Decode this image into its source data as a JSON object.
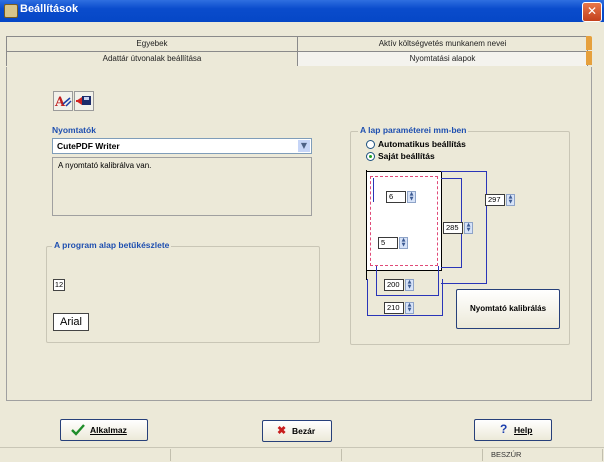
{
  "window": {
    "title": "Beállítások",
    "close_glyph": "✕"
  },
  "tabs_row1": [
    {
      "label": "Egyebek"
    },
    {
      "label": "Aktív költségvetés munkanem nevei"
    }
  ],
  "tabs_row2": [
    {
      "label": "Adattár útvonalak beállítása"
    },
    {
      "label": "Nyomtatási alapok",
      "active": true
    }
  ],
  "toolbar": {
    "icons": [
      "font-icon",
      "printer-exit-icon"
    ]
  },
  "printers": {
    "title": "Nyomtatók",
    "selected": "CutePDF Writer",
    "info": "A nyomtató kalibrálva van."
  },
  "font": {
    "title": "A program alap betűkészlete",
    "size": "12",
    "name": "Arial"
  },
  "paper": {
    "title": "A lap paraméterei mm-ben",
    "option_auto": "Automatikus beállítás",
    "option_custom": "Saját beállítás",
    "selected": "custom",
    "top": "6",
    "left": "5",
    "print_height": "285",
    "page_height": "297",
    "print_width": "200",
    "page_width": "210",
    "calibrate_button": "Nyomtató kalibrálás"
  },
  "buttons": {
    "apply": "Alkalmaz",
    "close": "Bezár",
    "help": "Help"
  },
  "status": {
    "mode": "BESZÚR"
  },
  "colors": {
    "accent": "#1e4fb0",
    "titlebar": "#0a4ccc"
  }
}
